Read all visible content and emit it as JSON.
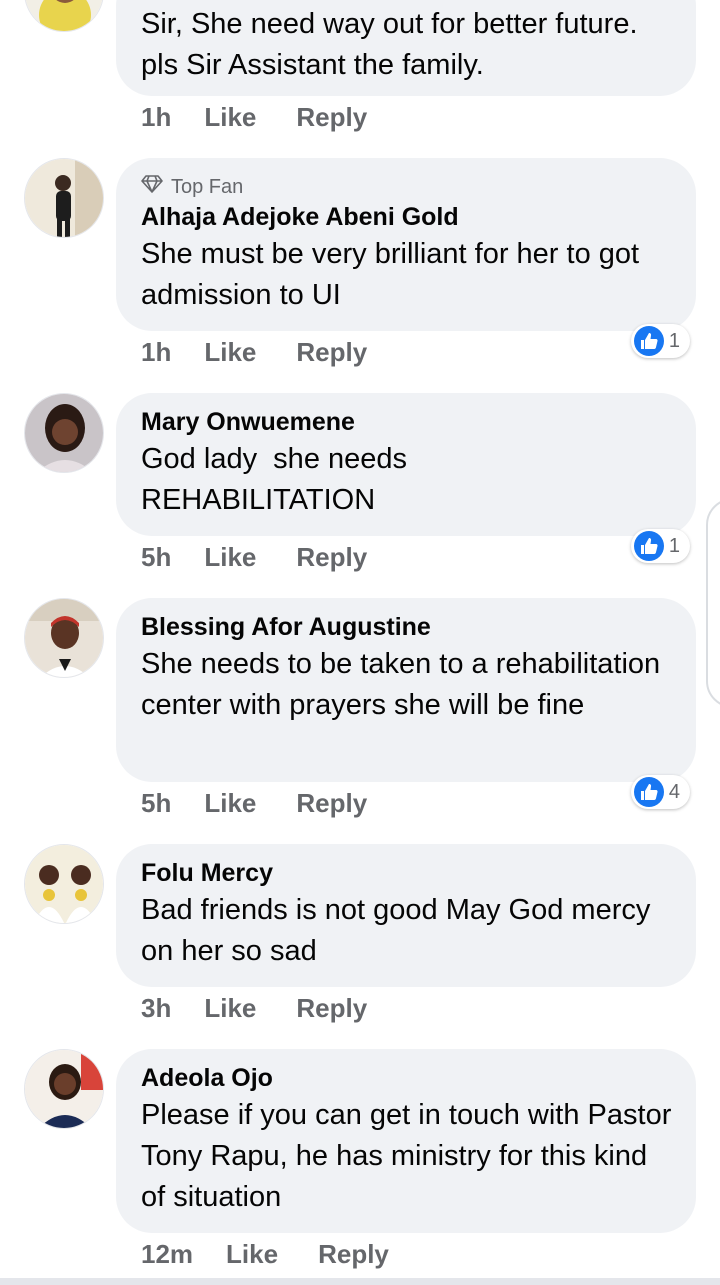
{
  "comments": [
    {
      "author": "",
      "text": "Sir, She need way out for better future. pls Sir Assistant the family.",
      "time": "1h",
      "like_label": "Like",
      "reply_label": "Reply"
    },
    {
      "badge": "Top Fan",
      "author": "Alhaja Adejoke Abeni Gold",
      "text": "She must be very brilliant for her to got admission to UI",
      "time": "1h",
      "like_label": "Like",
      "reply_label": "Reply",
      "reactions": "1"
    },
    {
      "author": "Mary Onwuemene",
      "text_lines": [
        "God lady  she needs",
        "REHABILITATION"
      ],
      "time": "5h",
      "like_label": "Like",
      "reply_label": "Reply",
      "reactions": "1"
    },
    {
      "author": "Blessing Afor Augustine",
      "text": "She needs to be taken to a rehabilitation center with prayers she will be fine",
      "time": "5h",
      "like_label": "Like",
      "reply_label": "Reply",
      "reactions": "4"
    },
    {
      "author": "Folu Mercy",
      "text": "Bad friends is not good May God mercy on her so sad",
      "time": "3h",
      "like_label": "Like",
      "reply_label": "Reply"
    },
    {
      "author": "Adeola Ojo",
      "text": "Please if you can get in touch with Pastor Tony Rapu, he has ministry for this kind of situation",
      "time": "12m",
      "like_label": "Like",
      "reply_label": "Reply"
    }
  ],
  "colors": {
    "bubble": "#f0f2f5",
    "meta_text": "#65676b",
    "like_blue": "#1877f2"
  },
  "icons": {
    "top_fan": "diamond-icon",
    "reaction": "thumbs-up-icon"
  }
}
